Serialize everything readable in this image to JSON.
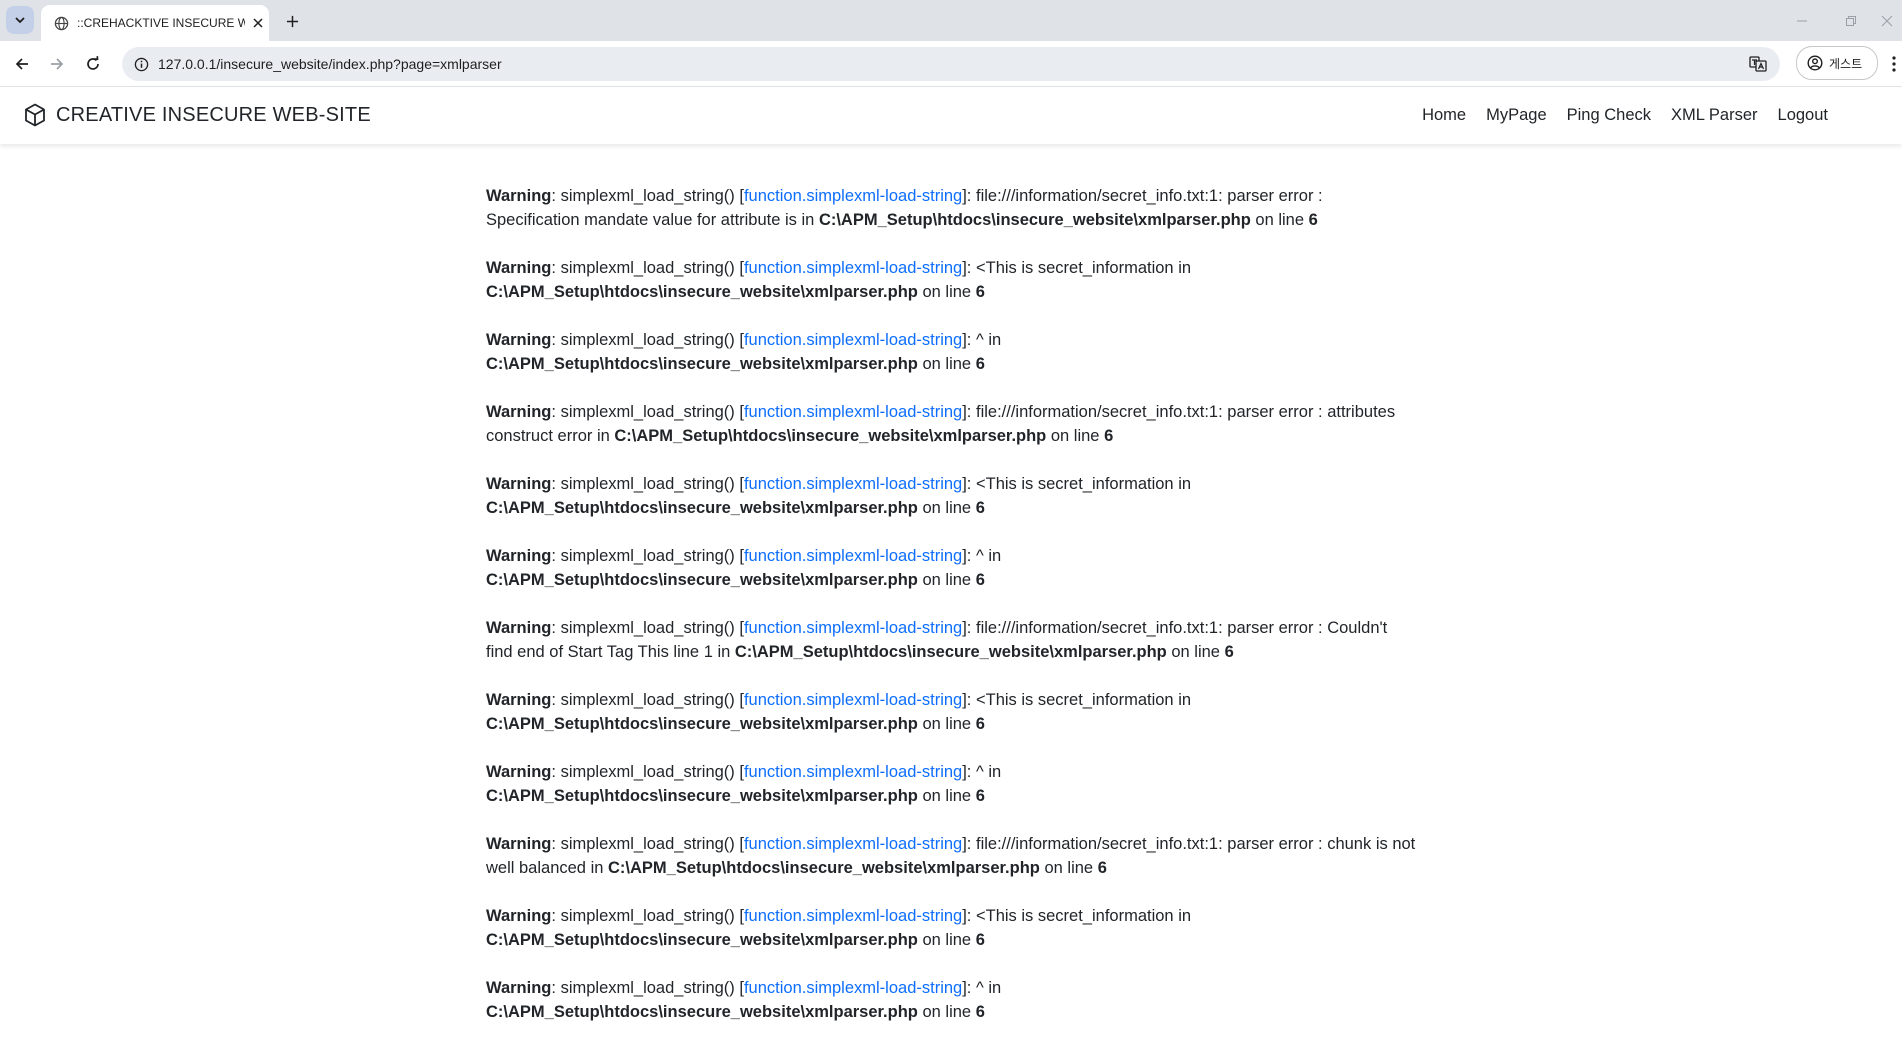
{
  "browser": {
    "tab_title": "::CREHACKTIVE INSECURE WEB-SITE::",
    "url": "127.0.0.1/insecure_website/index.php?page=xmlparser",
    "profile_label": "게스트"
  },
  "site": {
    "brand": "CREATIVE INSECURE WEB-SITE",
    "nav": [
      "Home",
      "MyPage",
      "Ping Check",
      "XML Parser",
      "Logout"
    ]
  },
  "warnings": [
    {
      "label": "Warning",
      "func": "simplexml_load_string()",
      "link": "function.simplexml-load-string",
      "message": "file:///information/secret_info.txt:1: parser error : Specification mandate value for attribute is",
      "file": "C:\\APM_Setup\\htdocs\\insecure_website\\xmlparser.php",
      "line_text": "on line",
      "line": "6"
    },
    {
      "label": "Warning",
      "func": "simplexml_load_string()",
      "link": "function.simplexml-load-string",
      "message": "<This is secret_information",
      "file": "C:\\APM_Setup\\htdocs\\insecure_website\\xmlparser.php",
      "line_text": "on line",
      "line": "6"
    },
    {
      "label": "Warning",
      "func": "simplexml_load_string()",
      "link": "function.simplexml-load-string",
      "message": "^",
      "file": "C:\\APM_Setup\\htdocs\\insecure_website\\xmlparser.php",
      "line_text": "on line",
      "line": "6"
    },
    {
      "label": "Warning",
      "func": "simplexml_load_string()",
      "link": "function.simplexml-load-string",
      "message": "file:///information/secret_info.txt:1: parser error : attributes construct error",
      "file": "C:\\APM_Setup\\htdocs\\insecure_website\\xmlparser.php",
      "line_text": "on line",
      "line": "6"
    },
    {
      "label": "Warning",
      "func": "simplexml_load_string()",
      "link": "function.simplexml-load-string",
      "message": "<This is secret_information",
      "file": "C:\\APM_Setup\\htdocs\\insecure_website\\xmlparser.php",
      "line_text": "on line",
      "line": "6"
    },
    {
      "label": "Warning",
      "func": "simplexml_load_string()",
      "link": "function.simplexml-load-string",
      "message": "^",
      "file": "C:\\APM_Setup\\htdocs\\insecure_website\\xmlparser.php",
      "line_text": "on line",
      "line": "6"
    },
    {
      "label": "Warning",
      "func": "simplexml_load_string()",
      "link": "function.simplexml-load-string",
      "message": "file:///information/secret_info.txt:1: parser error : Couldn't find end of Start Tag This line 1",
      "file": "C:\\APM_Setup\\htdocs\\insecure_website\\xmlparser.php",
      "line_text": "on line",
      "line": "6"
    },
    {
      "label": "Warning",
      "func": "simplexml_load_string()",
      "link": "function.simplexml-load-string",
      "message": "<This is secret_information",
      "file": "C:\\APM_Setup\\htdocs\\insecure_website\\xmlparser.php",
      "line_text": "on line",
      "line": "6"
    },
    {
      "label": "Warning",
      "func": "simplexml_load_string()",
      "link": "function.simplexml-load-string",
      "message": "^",
      "file": "C:\\APM_Setup\\htdocs\\insecure_website\\xmlparser.php",
      "line_text": "on line",
      "line": "6"
    },
    {
      "label": "Warning",
      "func": "simplexml_load_string()",
      "link": "function.simplexml-load-string",
      "message": "file:///information/secret_info.txt:1: parser error : chunk is not well balanced",
      "file": "C:\\APM_Setup\\htdocs\\insecure_website\\xmlparser.php",
      "line_text": "on line",
      "line": "6"
    },
    {
      "label": "Warning",
      "func": "simplexml_load_string()",
      "link": "function.simplexml-load-string",
      "message": "<This is secret_information",
      "file": "C:\\APM_Setup\\htdocs\\insecure_website\\xmlparser.php",
      "line_text": "on line",
      "line": "6"
    },
    {
      "label": "Warning",
      "func": "simplexml_load_string()",
      "link": "function.simplexml-load-string",
      "message": "^",
      "file": "C:\\APM_Setup\\htdocs\\insecure_website\\xmlparser.php",
      "line_text": "on line",
      "line": "6"
    }
  ],
  "colors": {
    "link": "#0d6efd",
    "text": "#212529",
    "tabstrip": "#dfe3e8",
    "omnibox": "#e9edf2"
  }
}
